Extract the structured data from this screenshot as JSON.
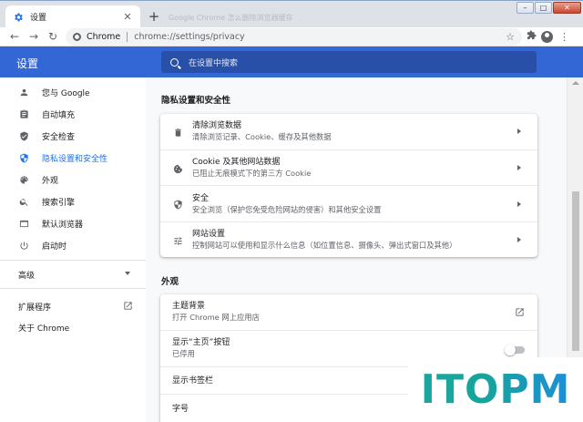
{
  "browser": {
    "tab_title": "设置",
    "ghost_tab_text": "Google Chrome 怎么删除浏览器缓存",
    "address_chip": "Chrome",
    "address_url": "chrome://settings/privacy",
    "window_buttons": {
      "minimize": "–",
      "maximize": "□",
      "close": "✕"
    }
  },
  "header": {
    "title": "设置",
    "search_placeholder": "在设置中搜索"
  },
  "sidebar": {
    "items": [
      {
        "label": "您与 Google",
        "icon": "person-icon"
      },
      {
        "label": "自动填充",
        "icon": "clipboard-icon"
      },
      {
        "label": "安全检查",
        "icon": "shield-check-icon"
      },
      {
        "label": "隐私设置和安全性",
        "icon": "shield-icon",
        "active": true
      },
      {
        "label": "外观",
        "icon": "palette-icon"
      },
      {
        "label": "搜索引擎",
        "icon": "search-icon"
      },
      {
        "label": "默认浏览器",
        "icon": "browser-icon"
      },
      {
        "label": "启动时",
        "icon": "power-icon"
      }
    ],
    "advanced": "高级",
    "extensions": "扩展程序",
    "about": "关于 Chrome"
  },
  "privacy": {
    "section_title": "隐私设置和安全性",
    "rows": [
      {
        "title": "清除浏览数据",
        "subtitle": "清除浏览记录、Cookie、缓存及其他数据",
        "icon": "trash-icon"
      },
      {
        "title": "Cookie 及其他网站数据",
        "subtitle": "已阻止无痕模式下的第三方 Cookie",
        "icon": "cookie-icon"
      },
      {
        "title": "安全",
        "subtitle": "安全浏览（保护您免受危险网站的侵害）和其他安全设置",
        "icon": "shield-icon"
      },
      {
        "title": "网站设置",
        "subtitle": "控制网站可以使用和显示什么信息（如位置信息、摄像头、弹出式窗口及其他）",
        "icon": "sliders-icon"
      }
    ]
  },
  "appearance": {
    "section_title": "外观",
    "theme_title": "主题背景",
    "theme_subtitle": "打开 Chrome 网上应用店",
    "home_title": "显示“主页”按钮",
    "home_subtitle": "已停用",
    "home_toggle_on": false,
    "bookmarks_title": "显示书签栏",
    "font_title": "字号"
  },
  "watermark": "ITOPM",
  "colors": {
    "header_blue": "#3367d6",
    "active_blue": "#1a73e8",
    "background": "#f8f9fa"
  }
}
